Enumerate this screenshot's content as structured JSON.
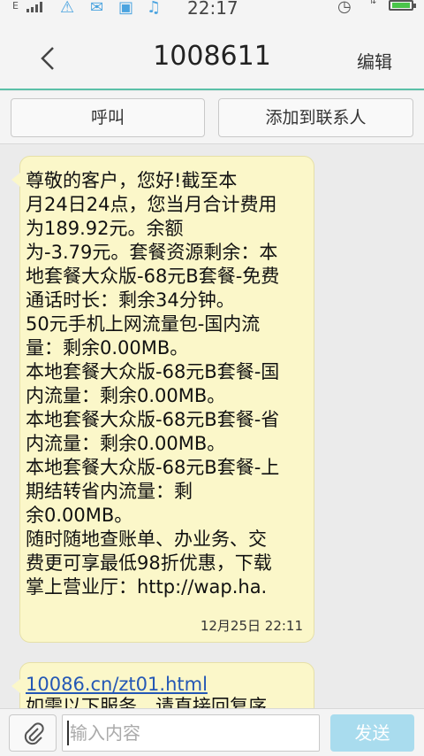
{
  "status_bar": {
    "network_type": "E",
    "time": "22:17"
  },
  "header": {
    "title": "1008611",
    "edit_label": "编辑"
  },
  "actions": {
    "call_label": "呼叫",
    "add_contact_label": "添加到联系人"
  },
  "messages": [
    {
      "text": "尊敬的客户，您好!截至本\n月24日24点，您当月合计费用\n为189.92元。余额\n为-3.79元。套餐资源剩余：本\n地套餐大众版-68元B套餐-免费\n通话时长：剩余34分钟。\n50元手机上网流量包-国内流\n量：剩余0.00MB。\n本地套餐大众版-68元B套餐-国\n内流量：剩余0.00MB。\n本地套餐大众版-68元B套餐-省\n内流量：剩余0.00MB。\n本地套餐大众版-68元B套餐-上\n期结转省内流量：剩\n余0.00MB。\n随时随地查账单、办业务、交\n费更可享最低98折优惠，下载\n掌上营业厅：http://wap.ha.",
      "time": "12月25日 22:11"
    },
    {
      "link": "10086.cn/zt01.html",
      "text": "如需以下服务，请直接回复序"
    }
  ],
  "composer": {
    "placeholder": "输入内容",
    "send_label": "发送"
  }
}
